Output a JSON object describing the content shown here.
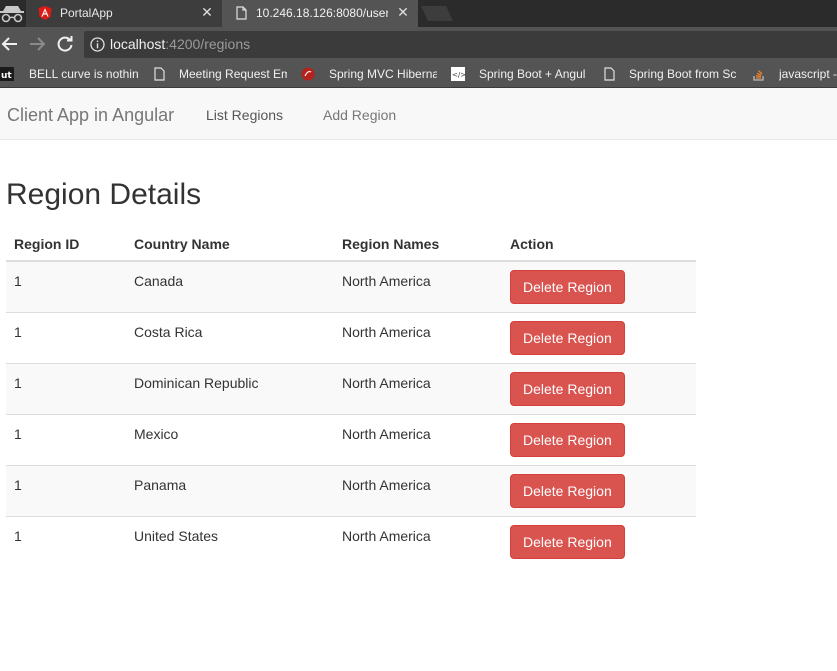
{
  "browser": {
    "tabs": [
      {
        "title": "PortalApp",
        "favicon": "angular-icon"
      },
      {
        "title": "10.246.18.126:8080/user-",
        "favicon": "page-icon"
      }
    ],
    "url": {
      "host": "localhost",
      "path": ":4200/regions"
    },
    "bookmarks": [
      {
        "label": "BELL curve is nothing",
        "icon": "bookmark-icon"
      },
      {
        "label": "Meeting Request Em",
        "icon": "page-icon"
      },
      {
        "label": "Spring MVC Hiberna",
        "icon": "spring-icon"
      },
      {
        "label": "Spring Boot + Angul",
        "icon": "code-icon"
      },
      {
        "label": "Spring Boot from Sc",
        "icon": "page-icon"
      },
      {
        "label": "javascript -",
        "icon": "stackoverflow-icon"
      }
    ]
  },
  "navbar": {
    "brand": "Client App in Angular",
    "links": [
      "List Regions",
      "Add Region"
    ]
  },
  "page": {
    "title": "Region Details",
    "columns": [
      "Region ID",
      "Country Name",
      "Region Names",
      "Action"
    ],
    "rows": [
      {
        "id": "1",
        "country": "Canada",
        "region": "North America",
        "action": "Delete Region"
      },
      {
        "id": "1",
        "country": "Costa Rica",
        "region": "North America",
        "action": "Delete Region"
      },
      {
        "id": "1",
        "country": "Dominican Republic",
        "region": "North America",
        "action": "Delete Region"
      },
      {
        "id": "1",
        "country": "Mexico",
        "region": "North America",
        "action": "Delete Region"
      },
      {
        "id": "1",
        "country": "Panama",
        "region": "North America",
        "action": "Delete Region"
      },
      {
        "id": "1",
        "country": "United States",
        "region": "North America",
        "action": "Delete Region"
      }
    ]
  },
  "colors": {
    "danger": "#d9534f",
    "navbar_bg": "#f8f8f8",
    "chrome_dark": "#2b2b2b",
    "chrome_mid": "#545454"
  }
}
